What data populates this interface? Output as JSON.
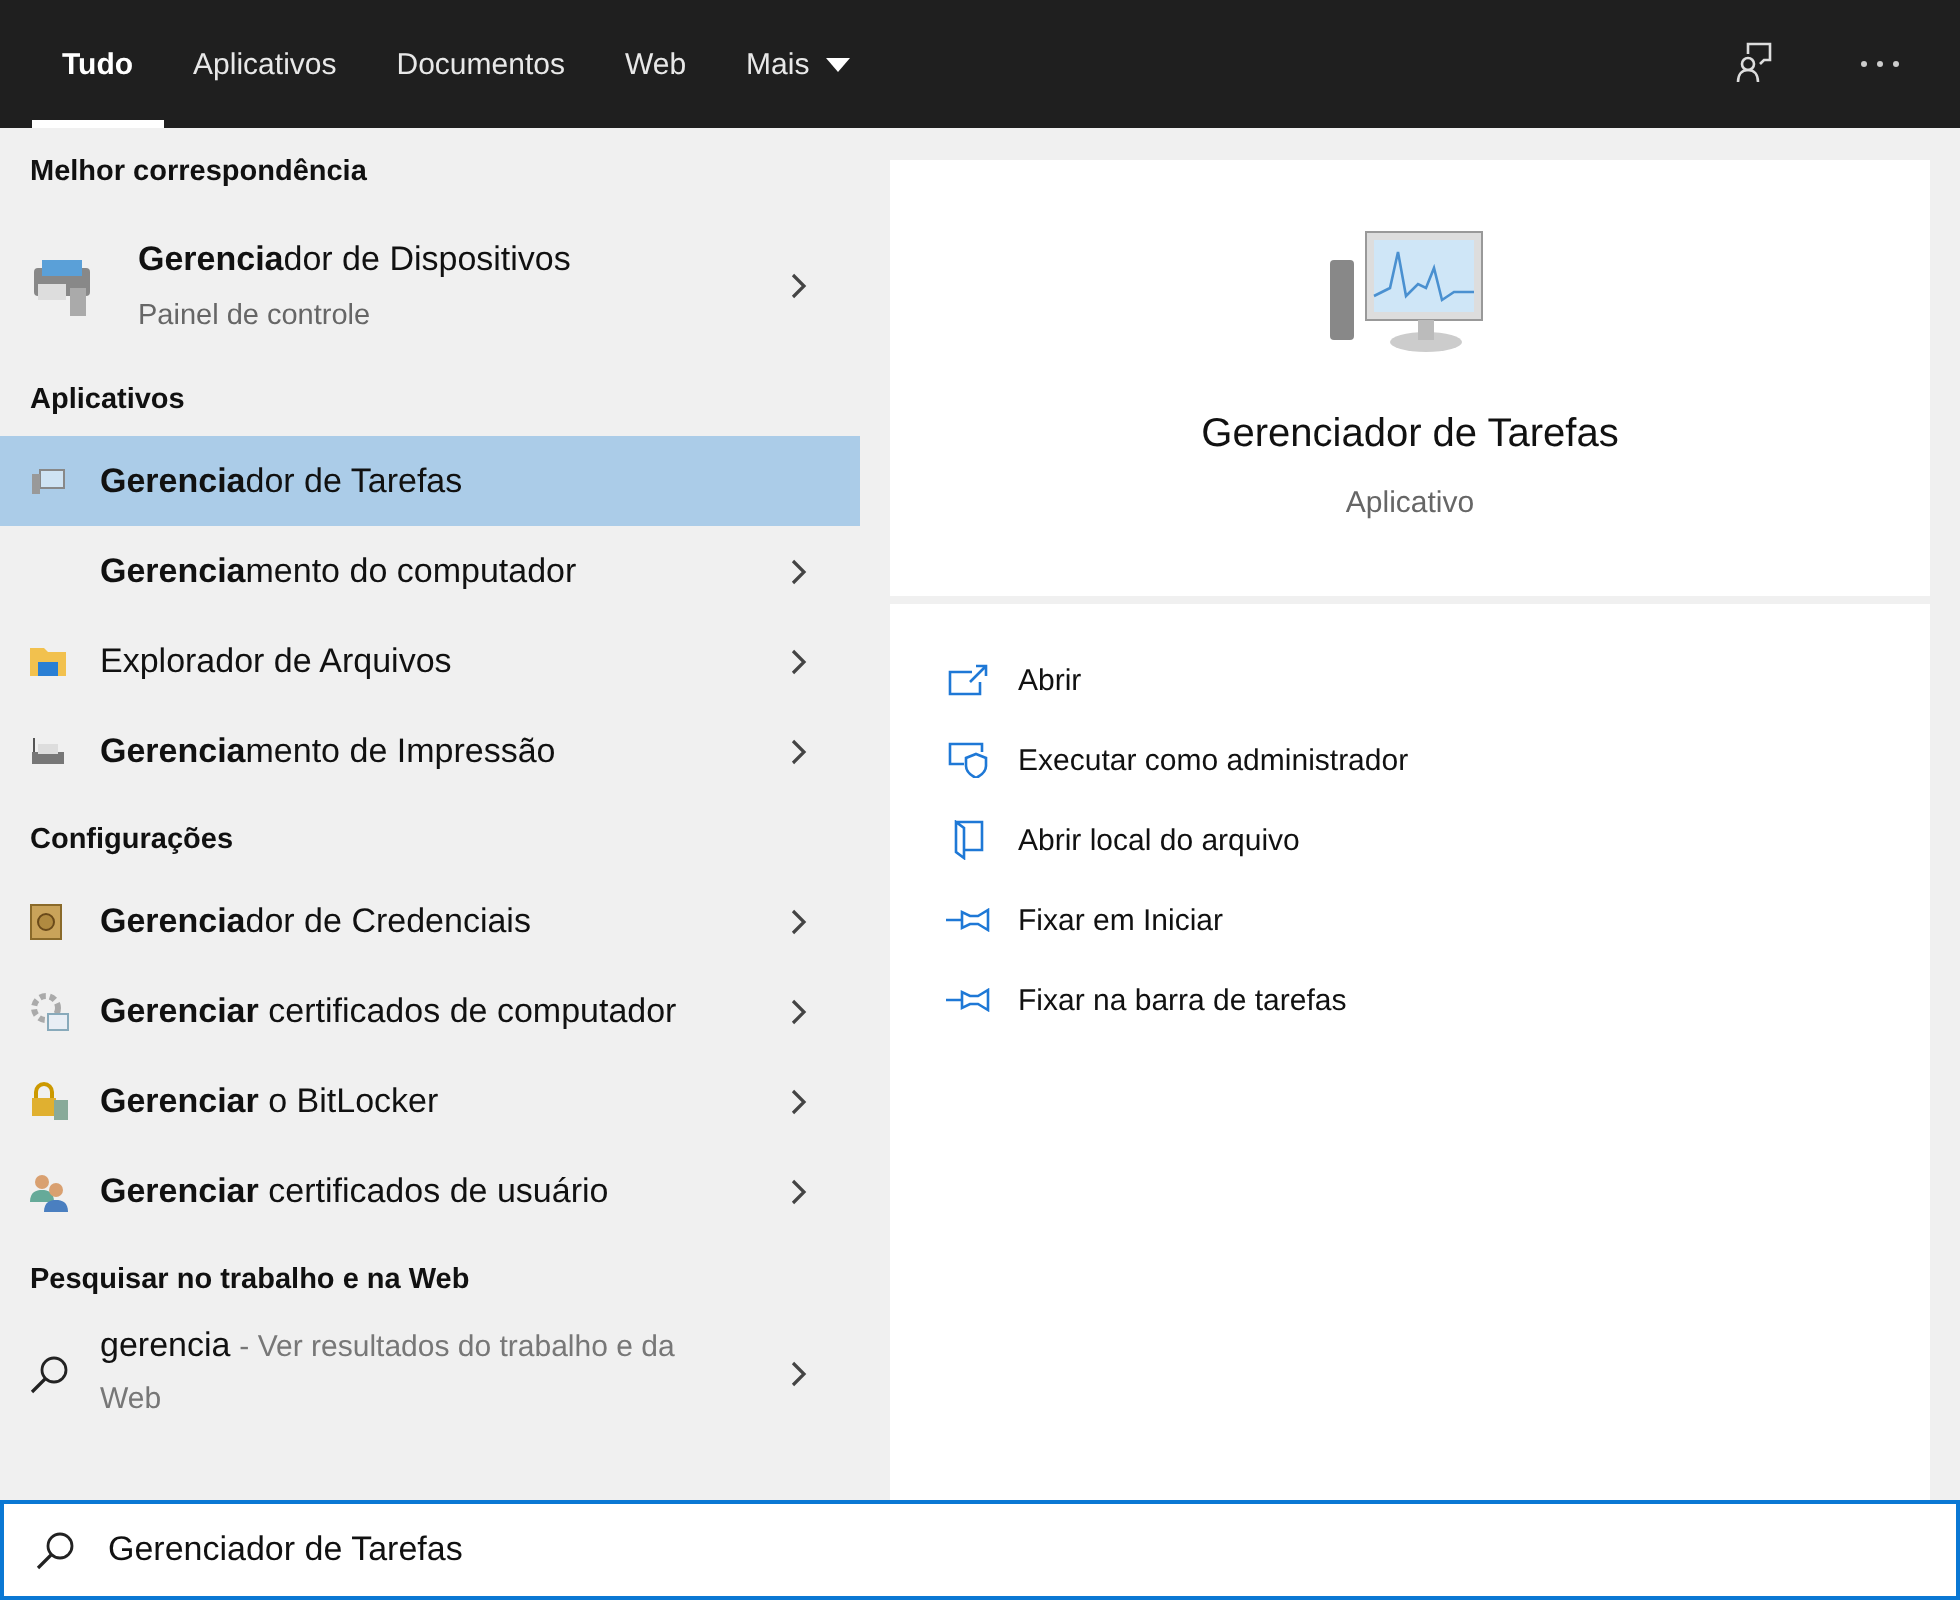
{
  "tabs": [
    {
      "label": "Tudo",
      "selected": true,
      "dropdown": false
    },
    {
      "label": "Aplicativos",
      "selected": false,
      "dropdown": false
    },
    {
      "label": "Documentos",
      "selected": false,
      "dropdown": false
    },
    {
      "label": "Web",
      "selected": false,
      "dropdown": false
    },
    {
      "label": "Mais",
      "selected": false,
      "dropdown": true
    }
  ],
  "best_match": {
    "heading": "Melhor correspondência",
    "title": "**Gerencia**dor de Dispositivos",
    "subtitle": "Painel de controle"
  },
  "sections": [
    {
      "heading": "Aplicativos",
      "items": [
        {
          "title": "**Gerencia**dor de Tarefas",
          "selected": true,
          "chevron": false
        },
        {
          "title": "**Gerencia**mento do computador",
          "selected": false,
          "chevron": true
        },
        {
          "title": "Explorador de Arquivos",
          "selected": false,
          "chevron": true
        },
        {
          "title": "**Gerencia**mento de Impressão",
          "selected": false,
          "chevron": true
        }
      ]
    },
    {
      "heading": "Configurações",
      "items": [
        {
          "title": "**Gerencia**dor de Credenciais",
          "selected": false,
          "chevron": true
        },
        {
          "title": "**Gerenciar** certificados de computador",
          "selected": false,
          "chevron": true
        },
        {
          "title": "**Gerenciar** o BitLocker",
          "selected": false,
          "chevron": true
        },
        {
          "title": "**Gerenciar** certificados de usuário",
          "selected": false,
          "chevron": true
        }
      ]
    }
  ],
  "web": {
    "heading": "Pesquisar no trabalho e na Web",
    "query": "gerencia",
    "hint": "- Ver resultados do trabalho e da Web"
  },
  "detail": {
    "title": "Gerenciador de Tarefas",
    "subtitle": "Aplicativo",
    "actions": [
      "Abrir",
      "Executar como administrador",
      "Abrir local do arquivo",
      "Fixar em Iniciar",
      "Fixar na barra de tarefas"
    ]
  },
  "search": {
    "value": "Gerenciador de Tarefas"
  }
}
